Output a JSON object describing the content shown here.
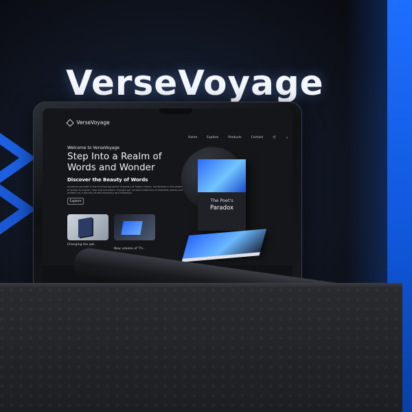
{
  "hero": {
    "brand_big": "VerseVoyage"
  },
  "site": {
    "logo": "VerseVoyage",
    "nav": [
      "Home",
      "Explore",
      "Products",
      "Contact"
    ],
    "welcome": "Welcome to VerseVoyage",
    "headline": "Step Into a Realm of Words and Wonder",
    "subhead": "Discover the Beauty of Words",
    "paragraph": "Immerse yourself in the enchanting world of poetry at Poetry Haven, we believe in the power of words to inspire, heal and transform. Explore our curated collection of heartfelt verses and embark on a journey of self-discovery and reflection.",
    "cta": "Explore",
    "thumb_captions": [
      "Changing the pat..",
      "New volume of 'Th.."
    ],
    "book": {
      "title_line1": "The Poet's",
      "title_line2": "Paradox"
    }
  }
}
